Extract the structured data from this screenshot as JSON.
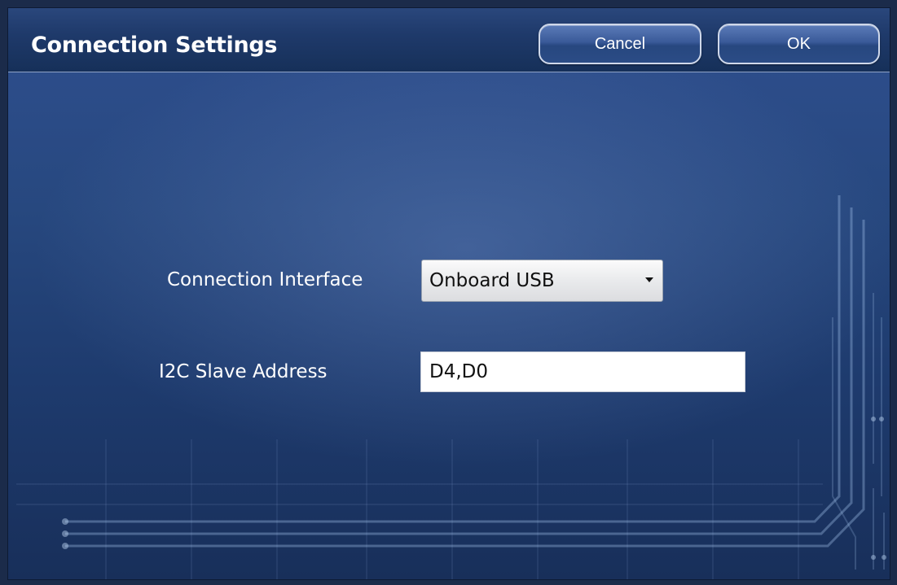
{
  "window": {
    "title": "Connection Settings"
  },
  "header": {
    "cancel_label": "Cancel",
    "ok_label": "OK"
  },
  "form": {
    "connection_interface": {
      "label": "Connection Interface",
      "selected": "Onboard USB"
    },
    "i2c_slave_address": {
      "label": "I2C Slave Address",
      "value": "D4,D0"
    }
  },
  "icons": {
    "dropdown": "chevron-down-icon",
    "background": "circuit-pattern"
  },
  "colors": {
    "window_bg": "#27487f",
    "header_bg": "#1f3a6b",
    "button_border": "#cfd8ea",
    "text": "#ffffff"
  }
}
